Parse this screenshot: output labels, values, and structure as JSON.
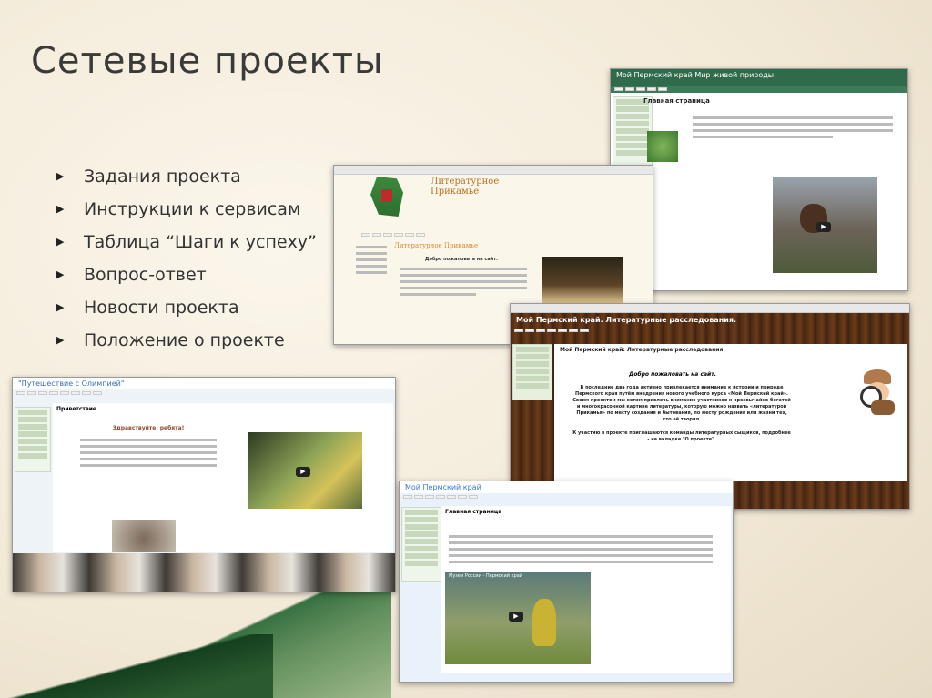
{
  "slide": {
    "title": "Сетевые проекты",
    "bullets": [
      "Задания проекта",
      "Инструкции к сервисам",
      "Таблица “Шаги к успеху”",
      "Вопрос-ответ",
      "Новости проекта",
      "Положение о проекте"
    ]
  },
  "screenshots": {
    "live_nature": {
      "header": "Мой Пермский край Мир живой природы",
      "page_title": "Главная страница",
      "colors": {
        "header": "#2f6a4a"
      }
    },
    "literary": {
      "logo_text": "Литературное Прикамье",
      "page_title": "Литературное Прикамье",
      "welcome": "Добро пожаловать на сайт.",
      "colors": {
        "accent": "#d48a2a"
      }
    },
    "investigations": {
      "header": "Мой Пермский край. Литературные расследования.",
      "page_title": "Мой Пермский край: Литературные расследования",
      "welcome": "Добро пожаловать на сайт.",
      "body": "В последние два года активно привлекается внимание к истории и природе Пермского края путём внедрения нового учебного курса «Мой Пермский край». Своим проектом мы хотим привлечь внимание участников к чрезвычайно богатой и многокрасочной картине литературы, которую можно назвать «литературой Прикамья» по месту создания и бытования, по месту рождения или жизни тех, кто её творил.",
      "footer": "К участию в проекте приглашаются команды литературных сыщиков, подробнее - на вкладке \"О проекте\".",
      "colors": {
        "frame": "#5a3416"
      }
    },
    "olympia": {
      "header": "\"Путешествие с Олимпией\"",
      "page_title": "Приветствие",
      "greeting": "Здравствуйте, ребята!",
      "colors": {
        "header": "#3c6fb0"
      }
    },
    "perm_krai": {
      "header": "Мой Пермский край",
      "page_title": "Главная страница",
      "video_title": "Музеи России - Пермский край",
      "colors": {
        "header": "#3a7ac8"
      }
    }
  }
}
